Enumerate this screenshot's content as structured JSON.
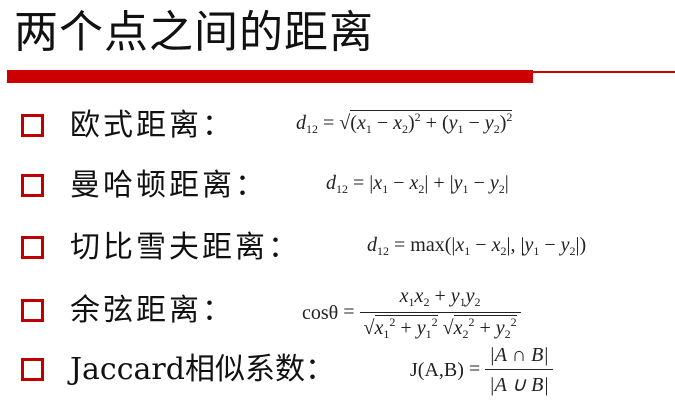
{
  "title": "两个点之间的距离",
  "items": [
    {
      "label": "欧式距离："
    },
    {
      "label": "曼哈顿距离："
    },
    {
      "label": "切比雪夫距离："
    },
    {
      "label": "余弦距离："
    },
    {
      "label": "Jaccard相似系数："
    }
  ],
  "formulas": {
    "euclid_lhs": "d",
    "sub12": "12",
    "eq": "=",
    "x": "x",
    "y": "y",
    "one": "1",
    "two": "2",
    "max": "max",
    "cos": "cosθ",
    "jac": "J(A,B)",
    "jac_num": "|A ∩ B|",
    "jac_den": "|A ∪ B|"
  },
  "colors": {
    "accent": "#cc0000",
    "checkbox_border": "#c00000"
  }
}
